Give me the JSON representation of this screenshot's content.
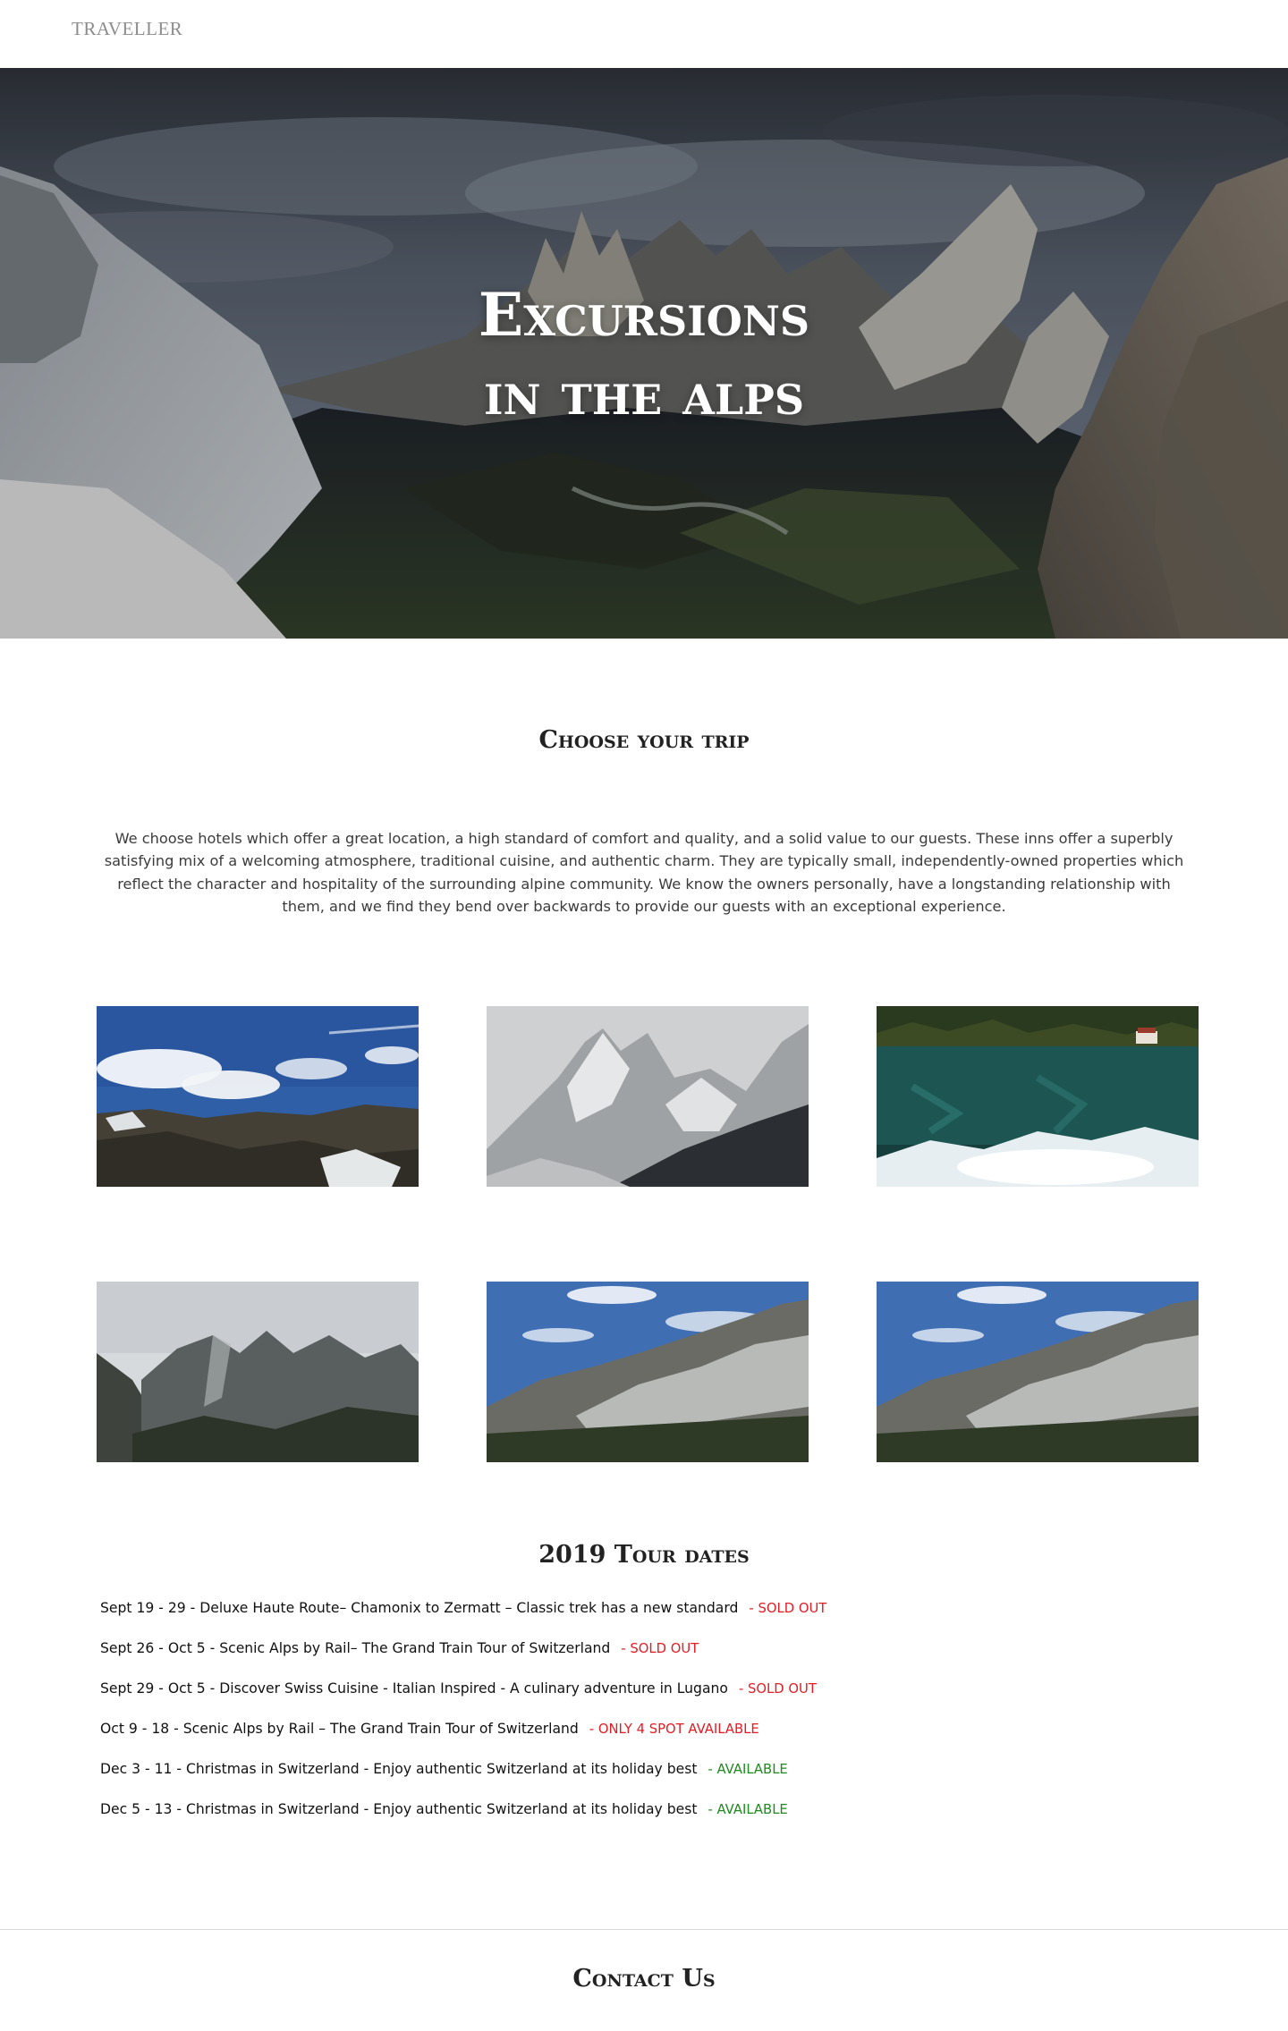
{
  "header": {
    "brand": "TRAVELLER"
  },
  "hero": {
    "title_line1": "Excursions",
    "title_line2": "in the alps"
  },
  "choose": {
    "title": "Choose your trip",
    "text": "We choose hotels which offer a great location, a high standard of comfort and quality, and a solid value to our guests. These inns offer a superbly satisfying mix of a welcoming atmosphere, traditional cuisine, and authentic charm. They are typically small, independently-owned properties which reflect the character and hospitality of the surrounding alpine community. We know the owners personally, have a longstanding relationship with them, and we find they bend over backwards to provide our guests with an exceptional experience."
  },
  "gallery": [
    {
      "name": "photo-blue-sky-ridge"
    },
    {
      "name": "photo-snowy-peaks"
    },
    {
      "name": "photo-alpine-lake"
    },
    {
      "name": "photo-grey-mountains"
    },
    {
      "name": "photo-dolomites-1"
    },
    {
      "name": "photo-dolomites-2"
    }
  ],
  "tours": {
    "title": "2019 Tour dates",
    "items": [
      {
        "text": "Sept 19 - 29 - Deluxe Haute Route– Chamonix to Zermatt – Classic trek has a new standard",
        "status": "- SOLD OUT",
        "status_color": "#e31b23"
      },
      {
        "text": "Sept 26 - Oct 5 - Scenic Alps by Rail– The Grand Train Tour of Switzerland",
        "status": "- SOLD OUT",
        "status_color": "#e31b23"
      },
      {
        "text": "Sept 29 - Oct 5 - Discover Swiss Cuisine - Italian Inspired - A culinary adventure in Lugano",
        "status": "- SOLD OUT",
        "status_color": "#e31b23"
      },
      {
        "text": "Oct 9 - 18 - Scenic Alps by Rail – The Grand Train Tour of Switzerland",
        "status": "- ONLY 4 SPOT AVAILABLE",
        "status_color": "#e31b23"
      },
      {
        "text": "Dec 3 - 11 - Christmas in Switzerland - Enjoy authentic Switzerland at its holiday best",
        "status": "- AVAILABLE",
        "status_color": "#1f8a1f"
      },
      {
        "text": "Dec 5 - 13 - Christmas in Switzerland - Enjoy authentic Switzerland at its holiday best",
        "status": "- AVAILABLE",
        "status_color": "#1f8a1f"
      }
    ]
  },
  "contact": {
    "title": "Contact Us"
  }
}
